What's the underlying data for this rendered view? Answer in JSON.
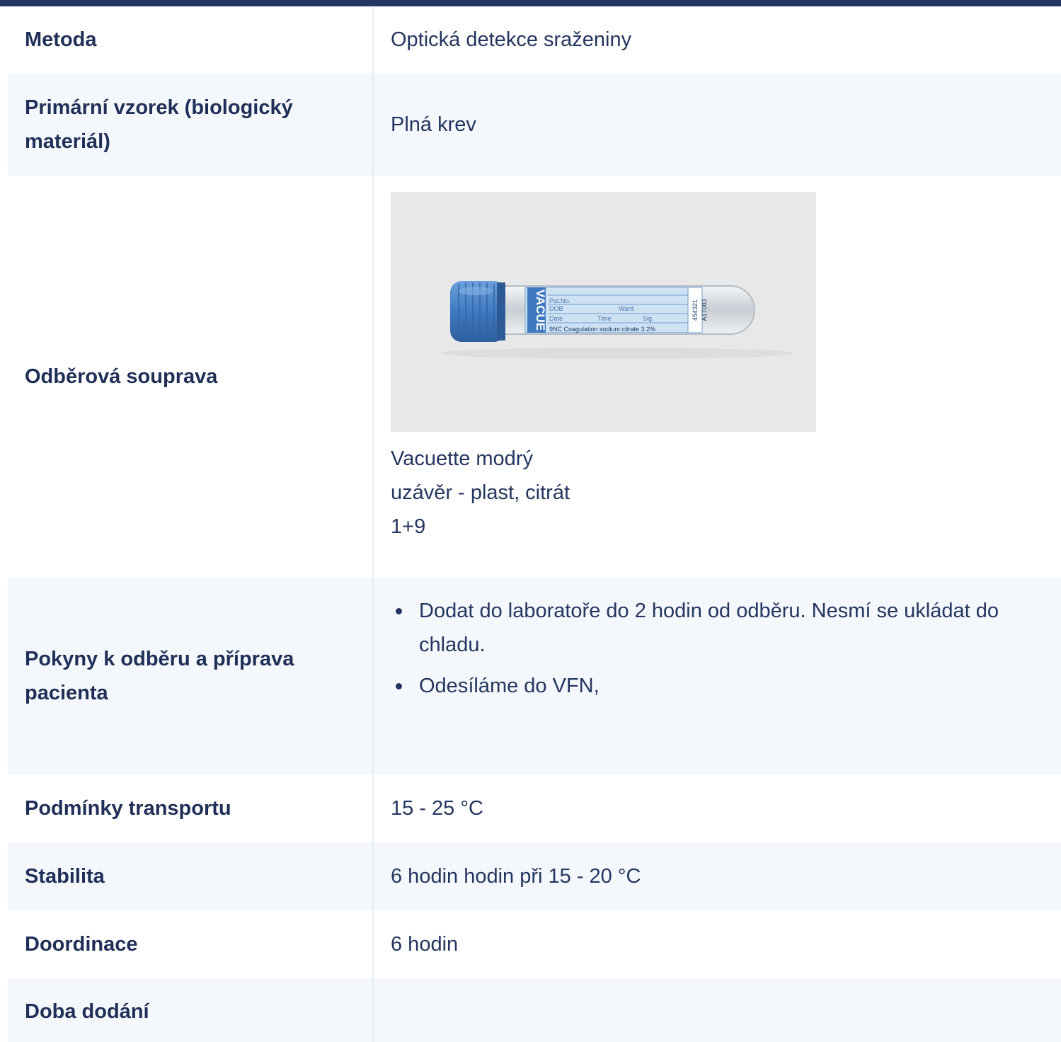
{
  "rows": [
    {
      "label": "Metoda",
      "value": "Optická detekce sraženiny"
    },
    {
      "label": "Primární vzorek (biologický materiál)",
      "value": "Plná krev"
    },
    {
      "label": "Odběrová souprava",
      "image": {
        "icon": "vacuette-blue-tube-image",
        "cap_color": "#4a86c8",
        "tube_label_lines": [
          "Pat.No.",
          "DOB",
          "Ward",
          "Date",
          "Time",
          "Sig.",
          "9NC Coagulation sodium citrate 3.2%",
          "454321",
          "A17083"
        ],
        "brand": "VACUETTE"
      },
      "lines": [
        "Vacuette modrý",
        "uzávěr - plast, citrát",
        "1+9"
      ]
    },
    {
      "label": "Pokyny k odběru a příprava pacienta",
      "items": [
        "Dodat do laboratoře do 2 hodin od odběru. Nesmí se ukládat do chladu.",
        "Odesíláme do VFN,"
      ]
    },
    {
      "label": "Podmínky transportu",
      "value": "15 - 25 °C"
    },
    {
      "label": "Stabilita",
      "value": "6 hodin hodin při 15 - 20 °C"
    },
    {
      "label": "Doordinace",
      "value": "6 hodin"
    },
    {
      "label": "Doba dodání",
      "value": ""
    }
  ],
  "colors": {
    "header_bar": "#243763",
    "label_text": "#1f2f57",
    "alt_row_bg": "#f4f8fc",
    "divider": "#e6ebf1"
  }
}
